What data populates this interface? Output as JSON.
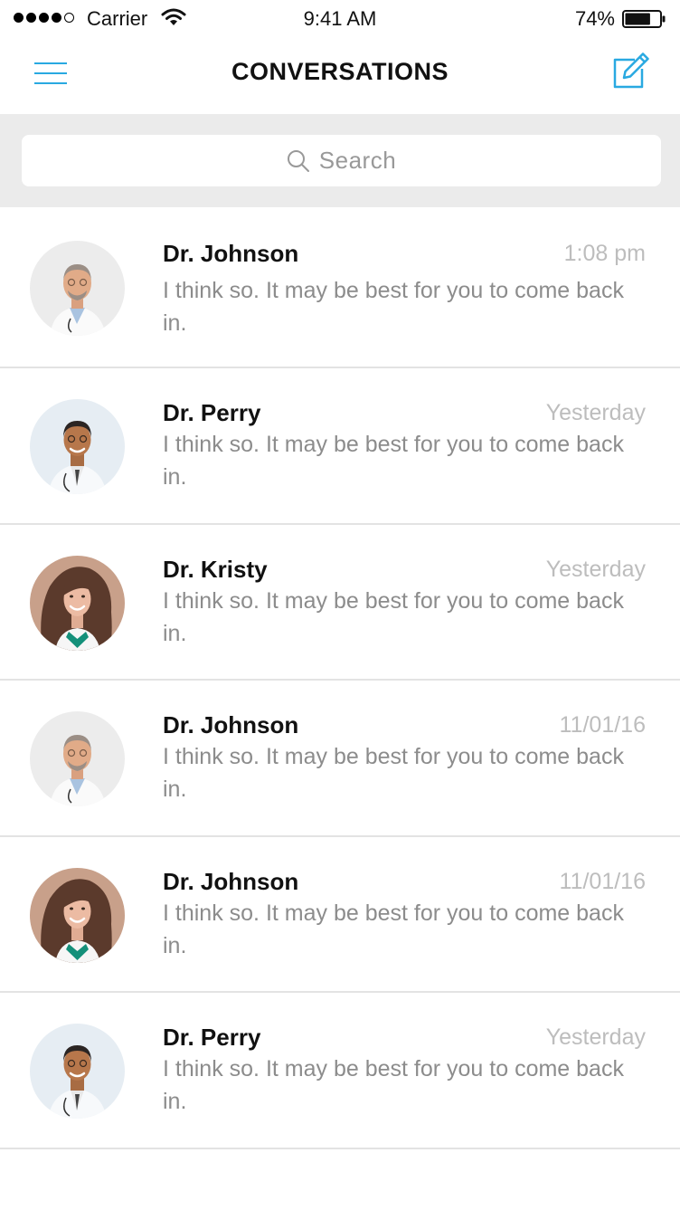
{
  "status_bar": {
    "carrier": "Carrier",
    "time": "9:41 AM",
    "battery": "74%",
    "battery_level": 0.74
  },
  "nav": {
    "title": "CONVERSATIONS",
    "accent_color": "#29a9e1",
    "left_icon": "hamburger-menu-icon",
    "right_icon": "compose-icon"
  },
  "search": {
    "placeholder": "Search",
    "icon": "search-icon"
  },
  "conversations": [
    {
      "name": "Dr. Johnson",
      "time": "1:08 pm",
      "preview": "I think so. It may be best for you to come back in.",
      "avatar": "male-doctor-gray-hair"
    },
    {
      "name": "Dr. Perry",
      "time": "Yesterday",
      "preview": "I think so. It may be best for you to come back in.",
      "avatar": "male-doctor-dark-hair"
    },
    {
      "name": "Dr. Kristy",
      "time": "Yesterday",
      "preview": "I think so. It may be best for you to come back in.",
      "avatar": "female-doctor"
    },
    {
      "name": "Dr. Johnson",
      "time": "11/01/16",
      "preview": "I think so. It may be best for you to come back in.",
      "avatar": "male-doctor-gray-hair"
    },
    {
      "name": "Dr. Johnson",
      "time": "11/01/16",
      "preview": "I think so. It may be best for you to come back in.",
      "avatar": "female-doctor"
    },
    {
      "name": "Dr. Perry",
      "time": "Yesterday",
      "preview": "I think so. It may be best for you to come back in.",
      "avatar": "male-doctor-dark-hair"
    }
  ]
}
